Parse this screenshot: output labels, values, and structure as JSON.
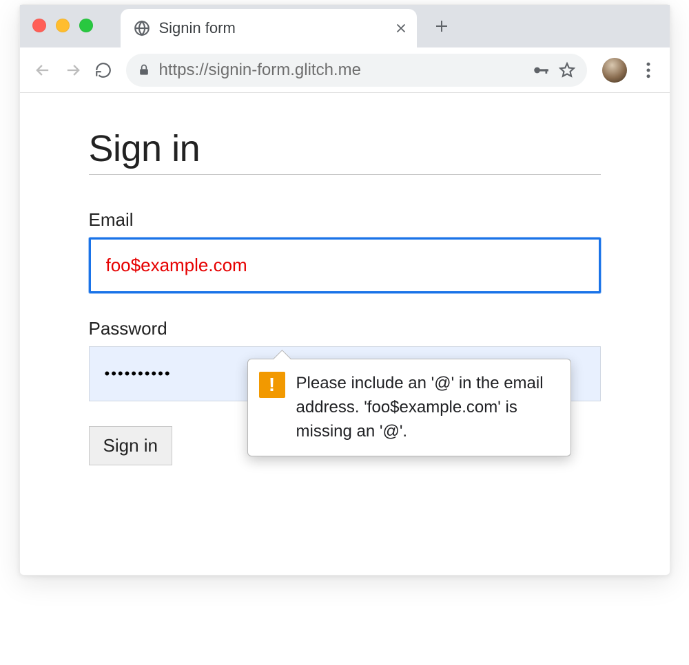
{
  "browser": {
    "tab_title": "Signin form",
    "url_display": "https://signin-form.glitch.me"
  },
  "page": {
    "heading": "Sign in",
    "email_label": "Email",
    "email_value": "foo$example.com",
    "password_label": "Password",
    "password_value": "••••••••••",
    "submit_label": "Sign in"
  },
  "validation": {
    "message": "Please include an '@' in the email address. 'foo$example.com' is missing an '@'."
  }
}
